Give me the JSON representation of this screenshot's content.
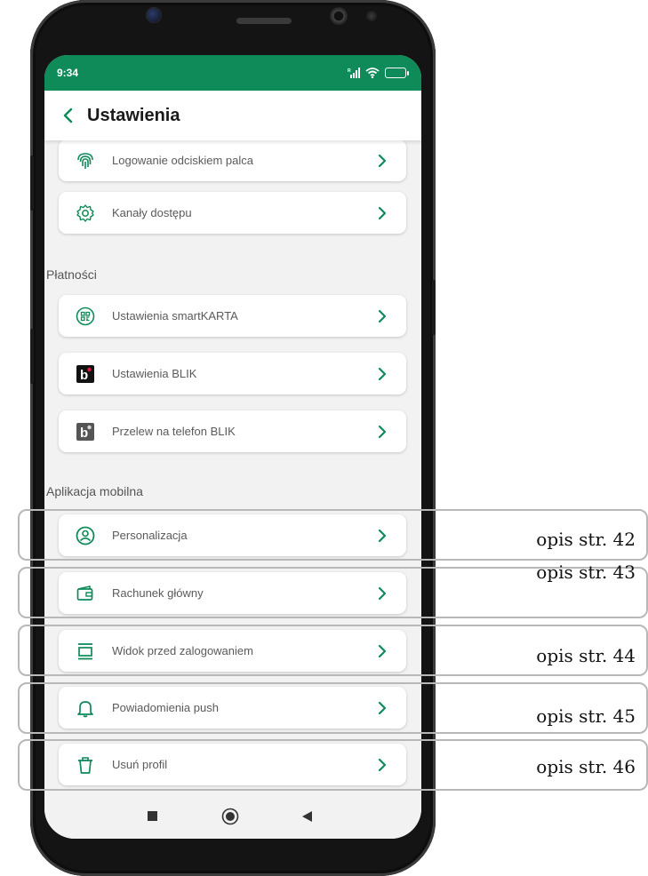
{
  "status": {
    "time": "9:34",
    "battery": "100"
  },
  "header": {
    "title": "Ustawienia"
  },
  "settings": {
    "items": [
      {
        "label": "Logowanie odciskiem palca",
        "icon": "fingerprint-icon"
      },
      {
        "label": "Kanały dostępu",
        "icon": "gear-icon"
      }
    ]
  },
  "payments": {
    "title": "Płatności",
    "items": [
      {
        "label": "Ustawienia smartKARTA",
        "icon": "qr-card-icon"
      },
      {
        "label": "Ustawienia BLIK",
        "icon": "blik-icon"
      },
      {
        "label": "Przelew na telefon BLIK",
        "icon": "blik-phone-icon"
      }
    ]
  },
  "mobile_app": {
    "title": "Aplikacja mobilna",
    "items": [
      {
        "label": "Personalizacja",
        "icon": "user-circle-icon",
        "reference": "opis str. 42"
      },
      {
        "label": "Rachunek główny",
        "icon": "wallet-icon",
        "reference": "opis str. 43"
      },
      {
        "label": "Widok przed zalogowaniem",
        "icon": "screen-view-icon",
        "reference": "opis str. 44"
      },
      {
        "label": "Powiadomienia push",
        "icon": "bell-icon",
        "reference": "opis str. 45"
      },
      {
        "label": "Usuń profil",
        "icon": "trash-icon",
        "reference": "opis str. 46"
      }
    ]
  },
  "colors": {
    "accent": "#0f8a59",
    "background": "#f2f2f2",
    "card": "#ffffff"
  }
}
